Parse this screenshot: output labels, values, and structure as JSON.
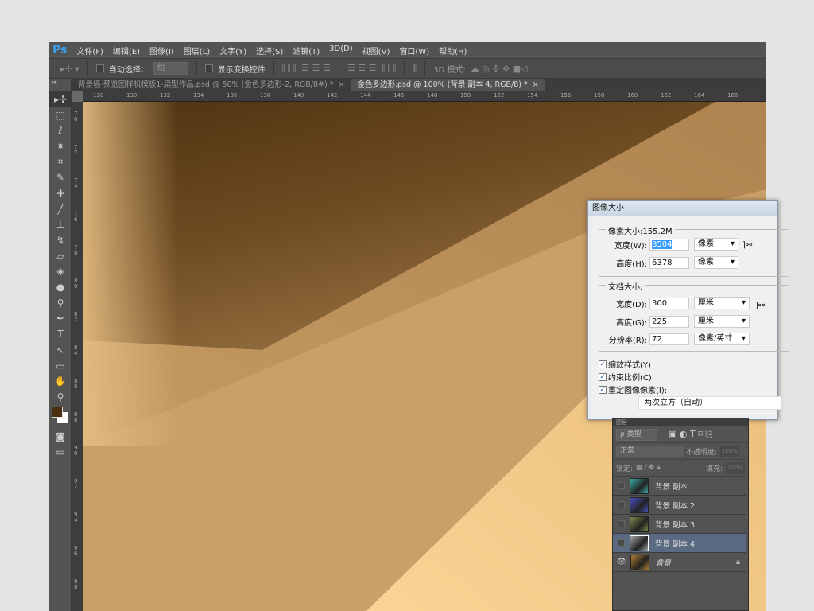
{
  "app": {
    "logo": "Ps"
  },
  "menu": [
    "文件(F)",
    "编辑(E)",
    "图像(I)",
    "图层(L)",
    "文字(Y)",
    "选择(S)",
    "滤镜(T)",
    "3D(D)",
    "视图(V)",
    "窗口(W)",
    "帮助(H)"
  ],
  "options": {
    "auto_select_label": "自动选择：",
    "auto_select_value": "组",
    "show_transform_label": "显示变换控件",
    "mode_3d_label": "3D 模式:"
  },
  "tabs": [
    {
      "label": "背景墙-预览图样机模板1-扁型作品.psd @ 50% (金色多边形-2, RGB/8#) *",
      "close": "×",
      "active": false
    },
    {
      "label": "金色多边形.psd @ 100% (背景 副本 4, RGB/8) *",
      "close": "×",
      "active": true
    }
  ],
  "ruler": {
    "horizontal": [
      "128",
      "130",
      "132",
      "134",
      "136",
      "138",
      "140",
      "142",
      "144",
      "146",
      "148",
      "150",
      "152",
      "154",
      "156",
      "158",
      "160",
      "162",
      "164",
      "166"
    ],
    "vertical": [
      "70",
      "72",
      "74",
      "76",
      "78",
      "80",
      "82",
      "84",
      "86",
      "88",
      "90",
      "92",
      "94",
      "96",
      "98"
    ]
  },
  "tools": [
    "move",
    "marquee",
    "lasso",
    "magic-wand",
    "crop",
    "eyedropper",
    "healing",
    "brush",
    "stamp",
    "history-brush",
    "eraser",
    "paint-bucket",
    "blur",
    "dodge",
    "pen",
    "type",
    "path-select",
    "rectangle",
    "hand",
    "zoom"
  ],
  "colors": {
    "foreground": "#4a3211",
    "background": "#ffffff",
    "accent": "#3aa0e8",
    "selected_layer": "#596a82"
  },
  "dialog": {
    "title": "图像大小",
    "pixel_size_label": "像素大小:155.2M",
    "width_label": "宽度(W):",
    "width_value": "8504",
    "width_unit": "像素",
    "height_label": "高度(H):",
    "height_value": "6378",
    "height_unit": "像素",
    "doc_size_label": "文档大小:",
    "doc_width_label": "宽度(D):",
    "doc_width_value": "300",
    "doc_width_unit": "厘米",
    "doc_height_label": "高度(G):",
    "doc_height_value": "225",
    "doc_height_unit": "厘米",
    "resolution_label": "分辨率(R):",
    "resolution_value": "72",
    "resolution_unit": "像素/英寸",
    "scale_styles": "缩放样式(Y)",
    "constrain": "约束比例(C)",
    "resample": "重定图像像素(I):",
    "resample_method": "两次立方（自动）",
    "scale_styles_checked": true,
    "constrain_checked": true,
    "resample_checked": true
  },
  "layers_panel": {
    "title": "图层",
    "filter": "ρ 类型",
    "blend_mode": "正常",
    "opacity_label": "不透明度:",
    "opacity_value": "100%",
    "lock_label": "锁定:",
    "fill_label": "填充:",
    "fill_value": "100%",
    "layers": [
      {
        "name": "背景 副本",
        "thumb": "#3aa8a0",
        "visible": false,
        "selected": false
      },
      {
        "name": "背景 副本 2",
        "thumb": "#4a50c0",
        "visible": false,
        "selected": false
      },
      {
        "name": "背景 副本 3",
        "thumb": "#7a8a4a",
        "visible": false,
        "selected": false
      },
      {
        "name": "背景 副本 4",
        "thumb": "#a0a0a0",
        "visible": false,
        "selected": true
      },
      {
        "name": "背景",
        "thumb": "#b07a30",
        "visible": true,
        "selected": false,
        "locked": true
      }
    ]
  }
}
